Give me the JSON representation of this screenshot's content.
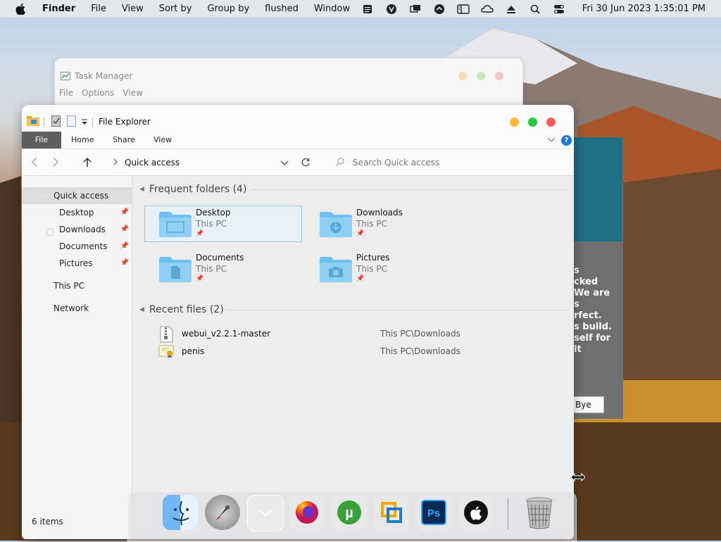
{
  "menubar": {
    "app": "Finder",
    "items": [
      "File",
      "View",
      "Sort by",
      "Group by",
      "flushed",
      "Window"
    ],
    "status_icons": [
      "notes-icon",
      "vpn-icon",
      "display-icon",
      "download-icon",
      "sidebar-icon",
      "cloud-icon",
      "eject-icon",
      "search-icon",
      "control-center-icon"
    ],
    "clock": "Fri 30 Jun 2023  1:35:01 PM"
  },
  "taskmgr": {
    "title": "Task Manager",
    "menu": [
      "File",
      "Options",
      "View"
    ]
  },
  "dialog": {
    "text": "s\ncked\nWe are\ns\nrfect.\ns build.\nself for\nit",
    "button": "Bye"
  },
  "explorer": {
    "title": "File Explorer",
    "ribbon": {
      "file": "File",
      "home": "Home",
      "share": "Share",
      "view": "View",
      "help": "?"
    },
    "path": "Quick access",
    "search_placeholder": "Search Quick access",
    "sidebar": {
      "items": [
        {
          "label": "Quick access"
        },
        {
          "label": "Desktop"
        },
        {
          "label": "Downloads"
        },
        {
          "label": "Documents"
        },
        {
          "label": "Pictures"
        },
        {
          "label": "This PC"
        },
        {
          "label": "Network"
        }
      ],
      "status": "6 items"
    },
    "frequent": {
      "heading": "Frequent folders (4)",
      "folders": [
        {
          "name": "Desktop",
          "loc": "This PC"
        },
        {
          "name": "Downloads",
          "loc": "This PC"
        },
        {
          "name": "Documents",
          "loc": "This PC"
        },
        {
          "name": "Pictures",
          "loc": "This PC"
        }
      ]
    },
    "recent": {
      "heading": "Recent files (2)",
      "files": [
        {
          "name": "webui_v2.2.1-master",
          "loc": "This PC\\Downloads"
        },
        {
          "name": "penis",
          "loc": "This PC\\Downloads"
        }
      ]
    }
  },
  "dock": {
    "apps": [
      "finder-icon",
      "launchpad-icon",
      "downloads-stack-icon",
      "firefox-icon",
      "utorrent-icon",
      "vmware-icon",
      "photoshop-icon",
      "apple-icon",
      "trash-icon"
    ]
  },
  "colors": {
    "close": "#ff5f57",
    "minimize": "#febc2e",
    "zoom": "#28c840",
    "folder": "#6fc0ef",
    "accent": "#1f78d1"
  }
}
